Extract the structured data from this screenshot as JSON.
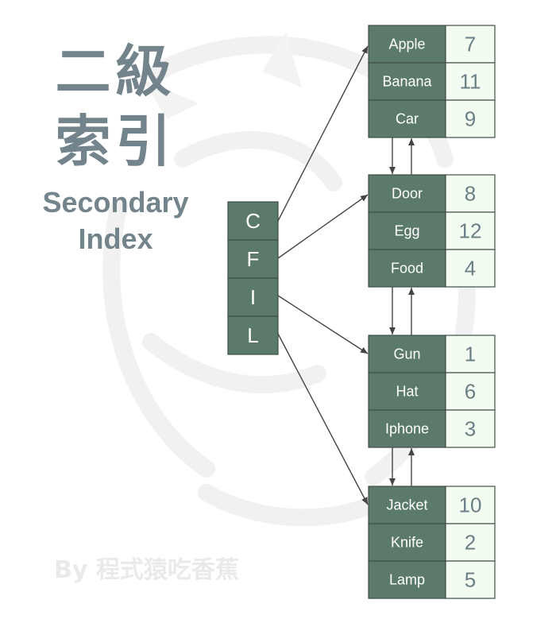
{
  "title": {
    "chinese_line1": "二級",
    "chinese_line2": "索引",
    "english_line1": "Secondary",
    "english_line2": "Index"
  },
  "byline": "By 程式猿吃香蕉",
  "colors": {
    "cell_dark": "#5b7a6b",
    "cell_light": "#f2fcf0",
    "border": "#3f4f47",
    "text_dark_cell": "#ffffff",
    "text_light_cell": "#6b7f86",
    "title": "#74848c",
    "arrow": "#444444"
  },
  "index_node": {
    "keys": [
      "C",
      "F",
      "I",
      "L"
    ]
  },
  "leaf_pages": [
    {
      "rows": [
        {
          "key": "Apple",
          "value": "7"
        },
        {
          "key": "Banana",
          "value": "11"
        },
        {
          "key": "Car",
          "value": "9"
        }
      ]
    },
    {
      "rows": [
        {
          "key": "Door",
          "value": "8"
        },
        {
          "key": "Egg",
          "value": "12"
        },
        {
          "key": "Food",
          "value": "4"
        }
      ]
    },
    {
      "rows": [
        {
          "key": "Gun",
          "value": "1"
        },
        {
          "key": "Hat",
          "value": "6"
        },
        {
          "key": "Iphone",
          "value": "3"
        }
      ]
    },
    {
      "rows": [
        {
          "key": "Jacket",
          "value": "10"
        },
        {
          "key": "Knife",
          "value": "2"
        },
        {
          "key": "Lamp",
          "value": "5"
        }
      ]
    }
  ]
}
